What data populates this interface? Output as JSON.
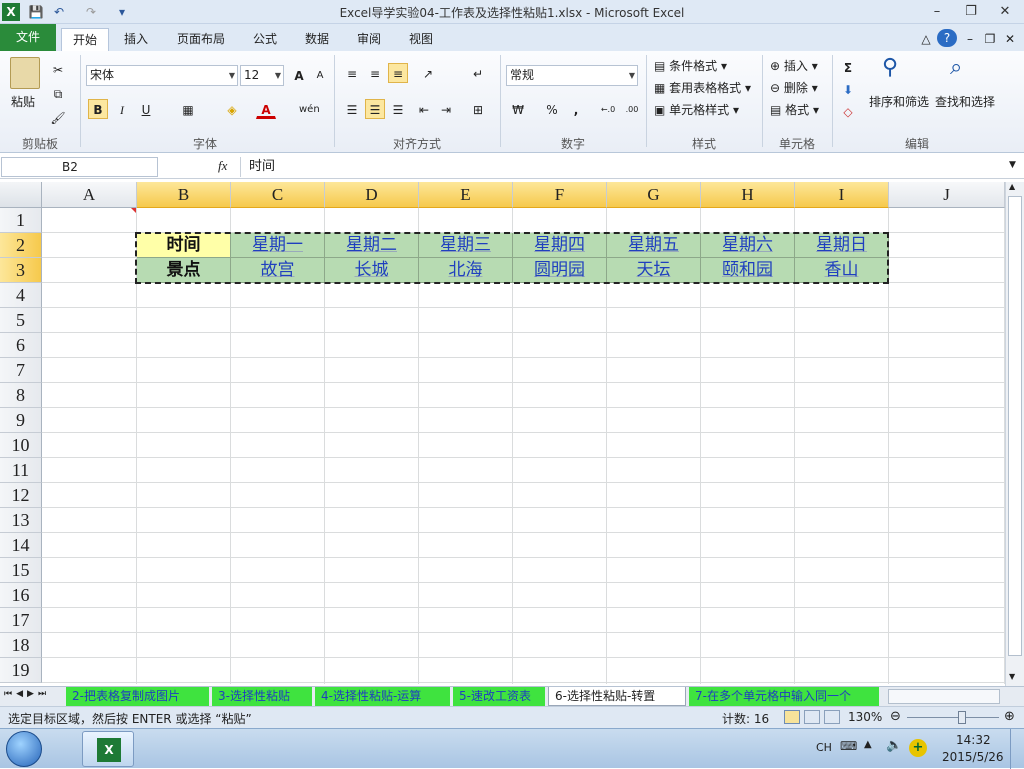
{
  "window": {
    "title": "Excel导学实验04-工作表及选择性粘贴1.xlsx  -  Microsoft Excel",
    "minimize": "–",
    "restore": "❐",
    "close": "✕"
  },
  "quick_access": {
    "save": "💾",
    "undo": "↶",
    "redo": "↷",
    "customize": "▾"
  },
  "tabs": {
    "file": "文件",
    "home": "开始",
    "insert": "插入",
    "page_layout": "页面布局",
    "formulas": "公式",
    "data": "数据",
    "review": "审阅",
    "view": "视图"
  },
  "ribbon": {
    "clipboard": {
      "label": "剪贴板",
      "paste": "粘贴"
    },
    "font": {
      "label": "字体",
      "name": "宋体",
      "size": "12",
      "bold": "B",
      "italic": "I",
      "underline": "U",
      "grow": "A",
      "shrink": "A",
      "color_letter": "A"
    },
    "alignment": {
      "label": "对齐方式"
    },
    "number": {
      "label": "数字",
      "format": "常规",
      "percent": "%",
      "comma": ",",
      "inc_decimal": "←.0",
      "dec_decimal": ".00"
    },
    "styles": {
      "label": "样式",
      "conditional": "条件格式",
      "table": "套用表格格式",
      "cell_styles": "单元格样式"
    },
    "cells": {
      "label": "单元格",
      "insert": "插入",
      "delete": "删除",
      "format": "格式"
    },
    "editing": {
      "label": "编辑",
      "sum": "Σ",
      "sort_filter": "排序和筛选",
      "find_select": "查找和选择"
    }
  },
  "formula_bar": {
    "name_box": "B2",
    "fx": "fx",
    "content": "时间"
  },
  "columns": [
    "A",
    "B",
    "C",
    "D",
    "E",
    "F",
    "G",
    "H",
    "I",
    "J"
  ],
  "rows": [
    "1",
    "2",
    "3",
    "4",
    "5",
    "6",
    "7",
    "8",
    "9",
    "10",
    "11",
    "12",
    "13",
    "14",
    "15",
    "16",
    "17",
    "18",
    "19"
  ],
  "table": {
    "row2": [
      "时间",
      "星期一",
      "星期二",
      "星期三",
      "星期四",
      "星期五",
      "星期六",
      "星期日"
    ],
    "row3": [
      "景点",
      "故宫",
      "长城",
      "北海",
      "圆明园",
      "天坛",
      "颐和园",
      "香山"
    ]
  },
  "sheet_tabs": [
    "2-把表格复制成图片",
    "3-选择性粘贴",
    "4-选择性粘贴-运算",
    "5-速改工资表",
    "6-选择性粘贴-转置",
    "7-在多个单元格中输入同一个"
  ],
  "active_sheet": "6-选择性粘贴-转置",
  "status": {
    "message": "选定目标区域，然后按 ENTER 或选择 “粘贴”",
    "count": "计数: 16",
    "zoom": "130%",
    "zoom_level": 0.6
  },
  "taskbar": {
    "lang": "CH",
    "time": "14:32",
    "date": "2015/5/26"
  },
  "colors": {
    "accent_green": "#2a8b3a",
    "cell_green": "#b7dbb2",
    "cell_yellow": "#ffffa8",
    "text_blue": "#1f3fbf",
    "sheet_tab_green": "#3fe33f"
  }
}
